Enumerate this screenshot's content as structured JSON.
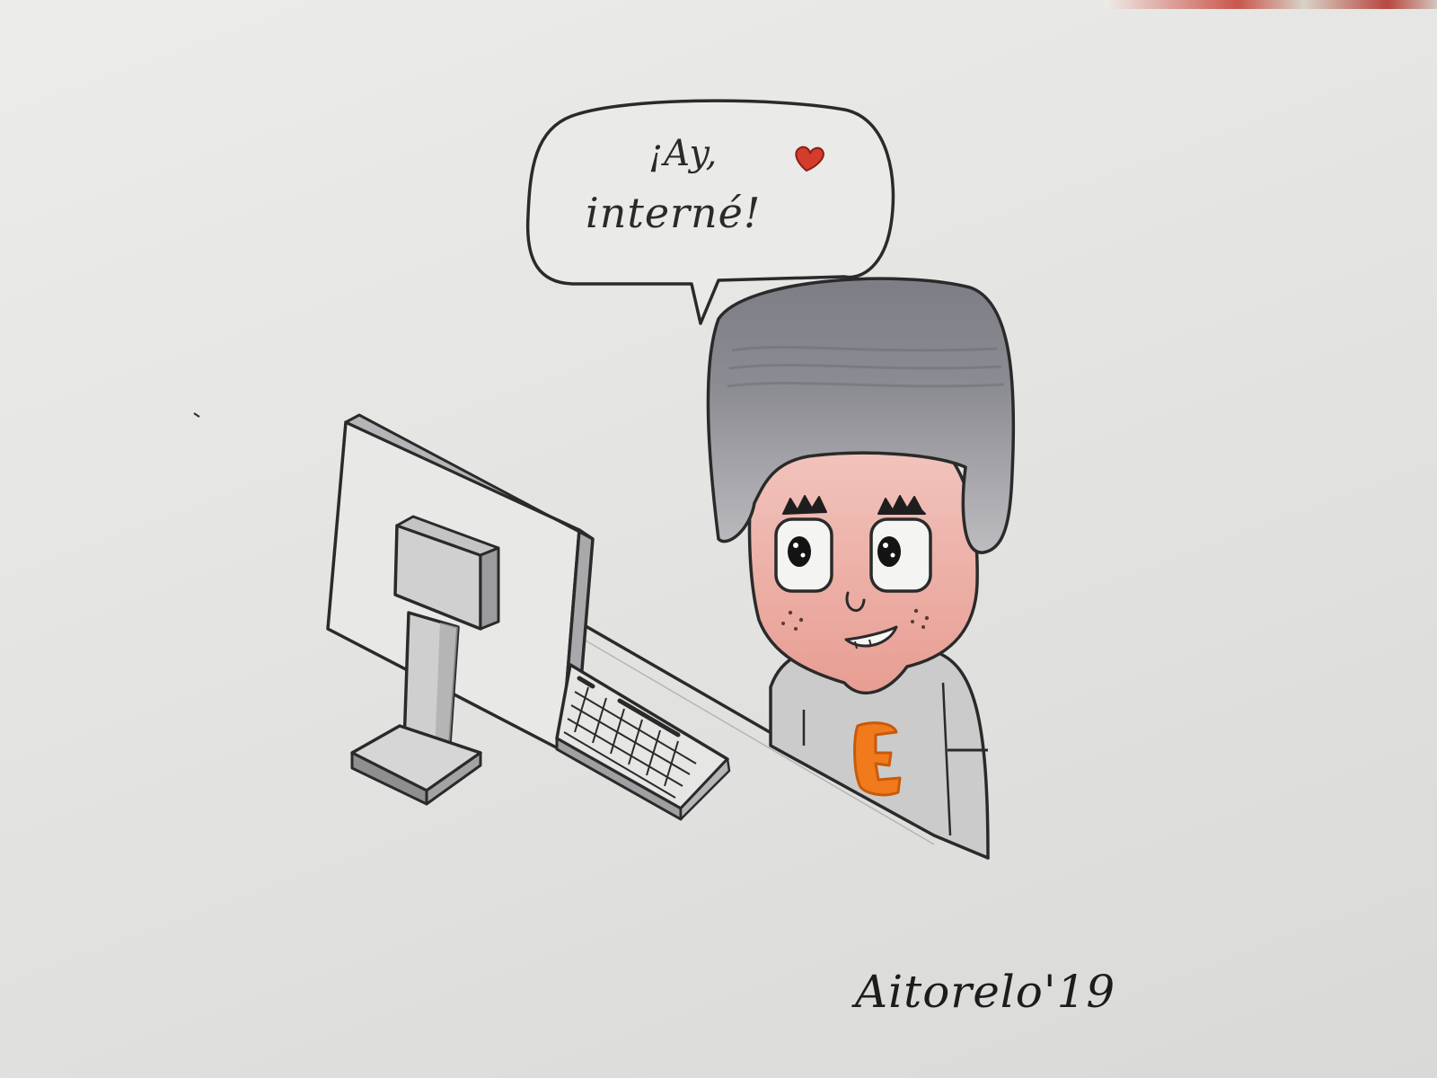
{
  "speech_bubble": {
    "line1": "¡Ay,",
    "line2": "interné!"
  },
  "signature": "Aitorelo'19",
  "icons": {
    "heart": "heart-icon"
  },
  "colors": {
    "paper": "#e4e4e2",
    "ink": "#2a2a2a",
    "hair": "#8f8f95",
    "skin": "#eeb0a8",
    "shirt": "#c8c8c8",
    "shirt_letter": "#f07a1c",
    "heart": "#d43c2c",
    "monitor": "#b9b9b9"
  },
  "shirt_letter": "E"
}
